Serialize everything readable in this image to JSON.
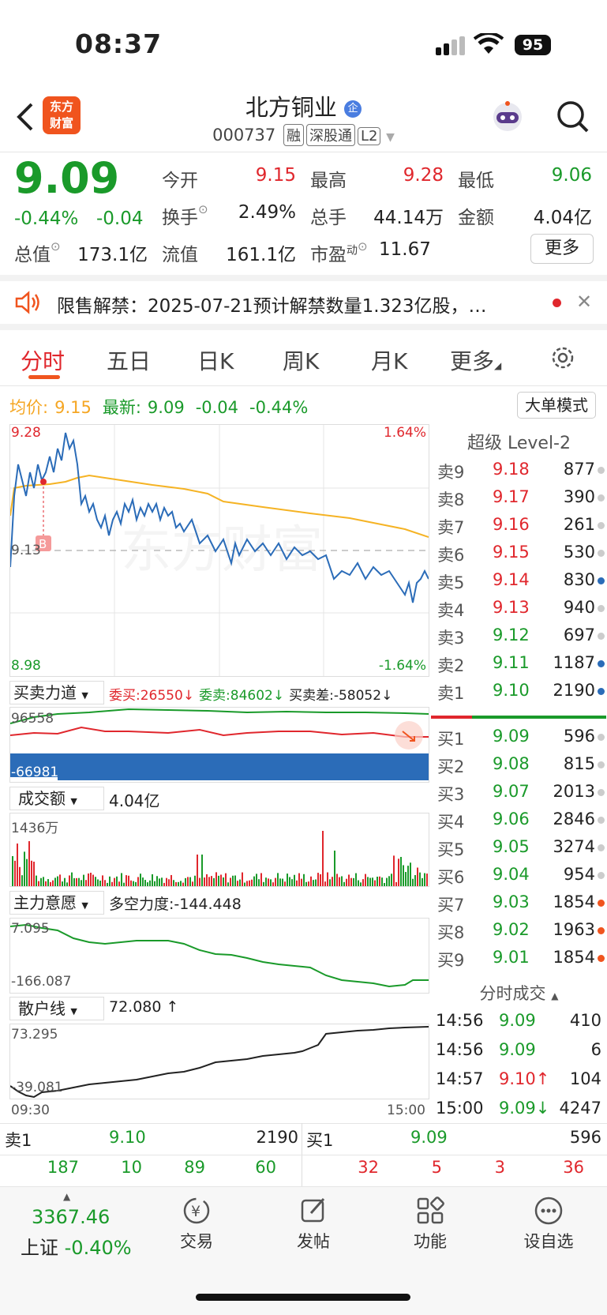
{
  "status": {
    "time": "08:37",
    "battery": "95"
  },
  "header": {
    "logo_line1": "东方",
    "logo_line2": "财富",
    "title": "北方铜业",
    "title_badge": "企",
    "code": "000737",
    "tags": [
      "融",
      "深股通",
      "L2"
    ]
  },
  "quote": {
    "price": "9.09",
    "pct": "-0.44%",
    "chg": "-0.04",
    "fields": [
      {
        "label": "今开",
        "value": "9.15",
        "color": "red"
      },
      {
        "label": "最高",
        "value": "9.28",
        "color": "red"
      },
      {
        "label": "最低",
        "value": "9.06",
        "color": "green"
      },
      {
        "label": "换手",
        "value": "2.49%",
        "color": "dark"
      },
      {
        "label": "总手",
        "value": "44.14万",
        "color": "dark"
      },
      {
        "label": "金额",
        "value": "4.04亿",
        "color": "dark"
      },
      {
        "label": "总值",
        "value": "173.1亿",
        "color": "dark"
      },
      {
        "label": "流值",
        "value": "161.1亿",
        "color": "dark"
      },
      {
        "label": "市盈",
        "value": "11.67",
        "color": "dark"
      }
    ],
    "more_button": "更多",
    "pe_sup": "动"
  },
  "notice": {
    "text": "限售解禁：2025-07-21预计解禁数量1.323亿股，…"
  },
  "tabs": [
    "分时",
    "五日",
    "日K",
    "周K",
    "月K",
    "更多"
  ],
  "chart_header": {
    "avg_label": "均价:",
    "avg_value": "9.15",
    "latest_label": "最新:",
    "latest_price": "9.09",
    "latest_chg": "-0.04",
    "latest_pct": "-0.44%",
    "mode_button": "大单模式"
  },
  "intraday": {
    "ymax": "9.28",
    "ymin": "8.98",
    "pct_max": "1.64%",
    "pct_min": "-1.64%",
    "mid": "9.13",
    "marker": "B",
    "watermark": "东方财富"
  },
  "power": {
    "label": "买卖力道",
    "weimai": "委买:26550",
    "weimai_arrow": "↓",
    "weimai2": "委卖:84602",
    "weimai2_arrow": "↓",
    "diff": "买卖差:-58052",
    "diff_arrow": "↓",
    "top": "96558",
    "bottom": "-66981"
  },
  "volume": {
    "label": "成交额",
    "total": "4.04亿",
    "max": "1436万"
  },
  "mainforce": {
    "label": "主力意愿",
    "strength": "多空力度:-144.448",
    "top": "7.095",
    "bottom": "-166.087"
  },
  "retail": {
    "label": "散户线",
    "value": "72.080",
    "arrow": "↑",
    "top": "73.295",
    "bottom": "-39.081",
    "t_start": "09:30",
    "t_end": "15:00"
  },
  "orderbook": {
    "title": "超级 Level-2",
    "asks": [
      [
        "卖9",
        "9.18",
        "877"
      ],
      [
        "卖8",
        "9.17",
        "390"
      ],
      [
        "卖7",
        "9.16",
        "261"
      ],
      [
        "卖6",
        "9.15",
        "530"
      ],
      [
        "卖5",
        "9.14",
        "830"
      ],
      [
        "卖4",
        "9.13",
        "940"
      ],
      [
        "卖3",
        "9.12",
        "697"
      ],
      [
        "卖2",
        "9.11",
        "1187"
      ],
      [
        "卖1",
        "9.10",
        "2190"
      ]
    ],
    "bids": [
      [
        "买1",
        "9.09",
        "596"
      ],
      [
        "买2",
        "9.08",
        "815"
      ],
      [
        "买3",
        "9.07",
        "2013"
      ],
      [
        "买4",
        "9.06",
        "2846"
      ],
      [
        "买5",
        "9.05",
        "3274"
      ],
      [
        "买6",
        "9.04",
        "954"
      ],
      [
        "买7",
        "9.03",
        "1854"
      ],
      [
        "买8",
        "9.02",
        "1963"
      ],
      [
        "买9",
        "9.01",
        "1854"
      ]
    ]
  },
  "trades": {
    "title": "分时成交",
    "rows": [
      [
        "14:56",
        "9.09",
        "",
        "410"
      ],
      [
        "14:56",
        "9.09",
        "",
        "6"
      ],
      [
        "14:57",
        "9.10",
        "↑",
        "104"
      ],
      [
        "15:00",
        "9.09",
        "↓",
        "4247"
      ]
    ]
  },
  "level_bar": {
    "sell_label": "卖1",
    "sell_price": "9.10",
    "sell_vol": "2190",
    "buy_label": "买1",
    "buy_price": "9.09",
    "buy_vol": "596",
    "sell_split": [
      "187",
      "10",
      "89",
      "60"
    ],
    "buy_split": [
      "32",
      "5",
      "3",
      "36"
    ]
  },
  "bottom_nav": {
    "index_value": "3367.46",
    "index_name": "上证",
    "index_pct": "-0.40%",
    "items": [
      "交易",
      "发帖",
      "功能",
      "设自选"
    ]
  }
}
